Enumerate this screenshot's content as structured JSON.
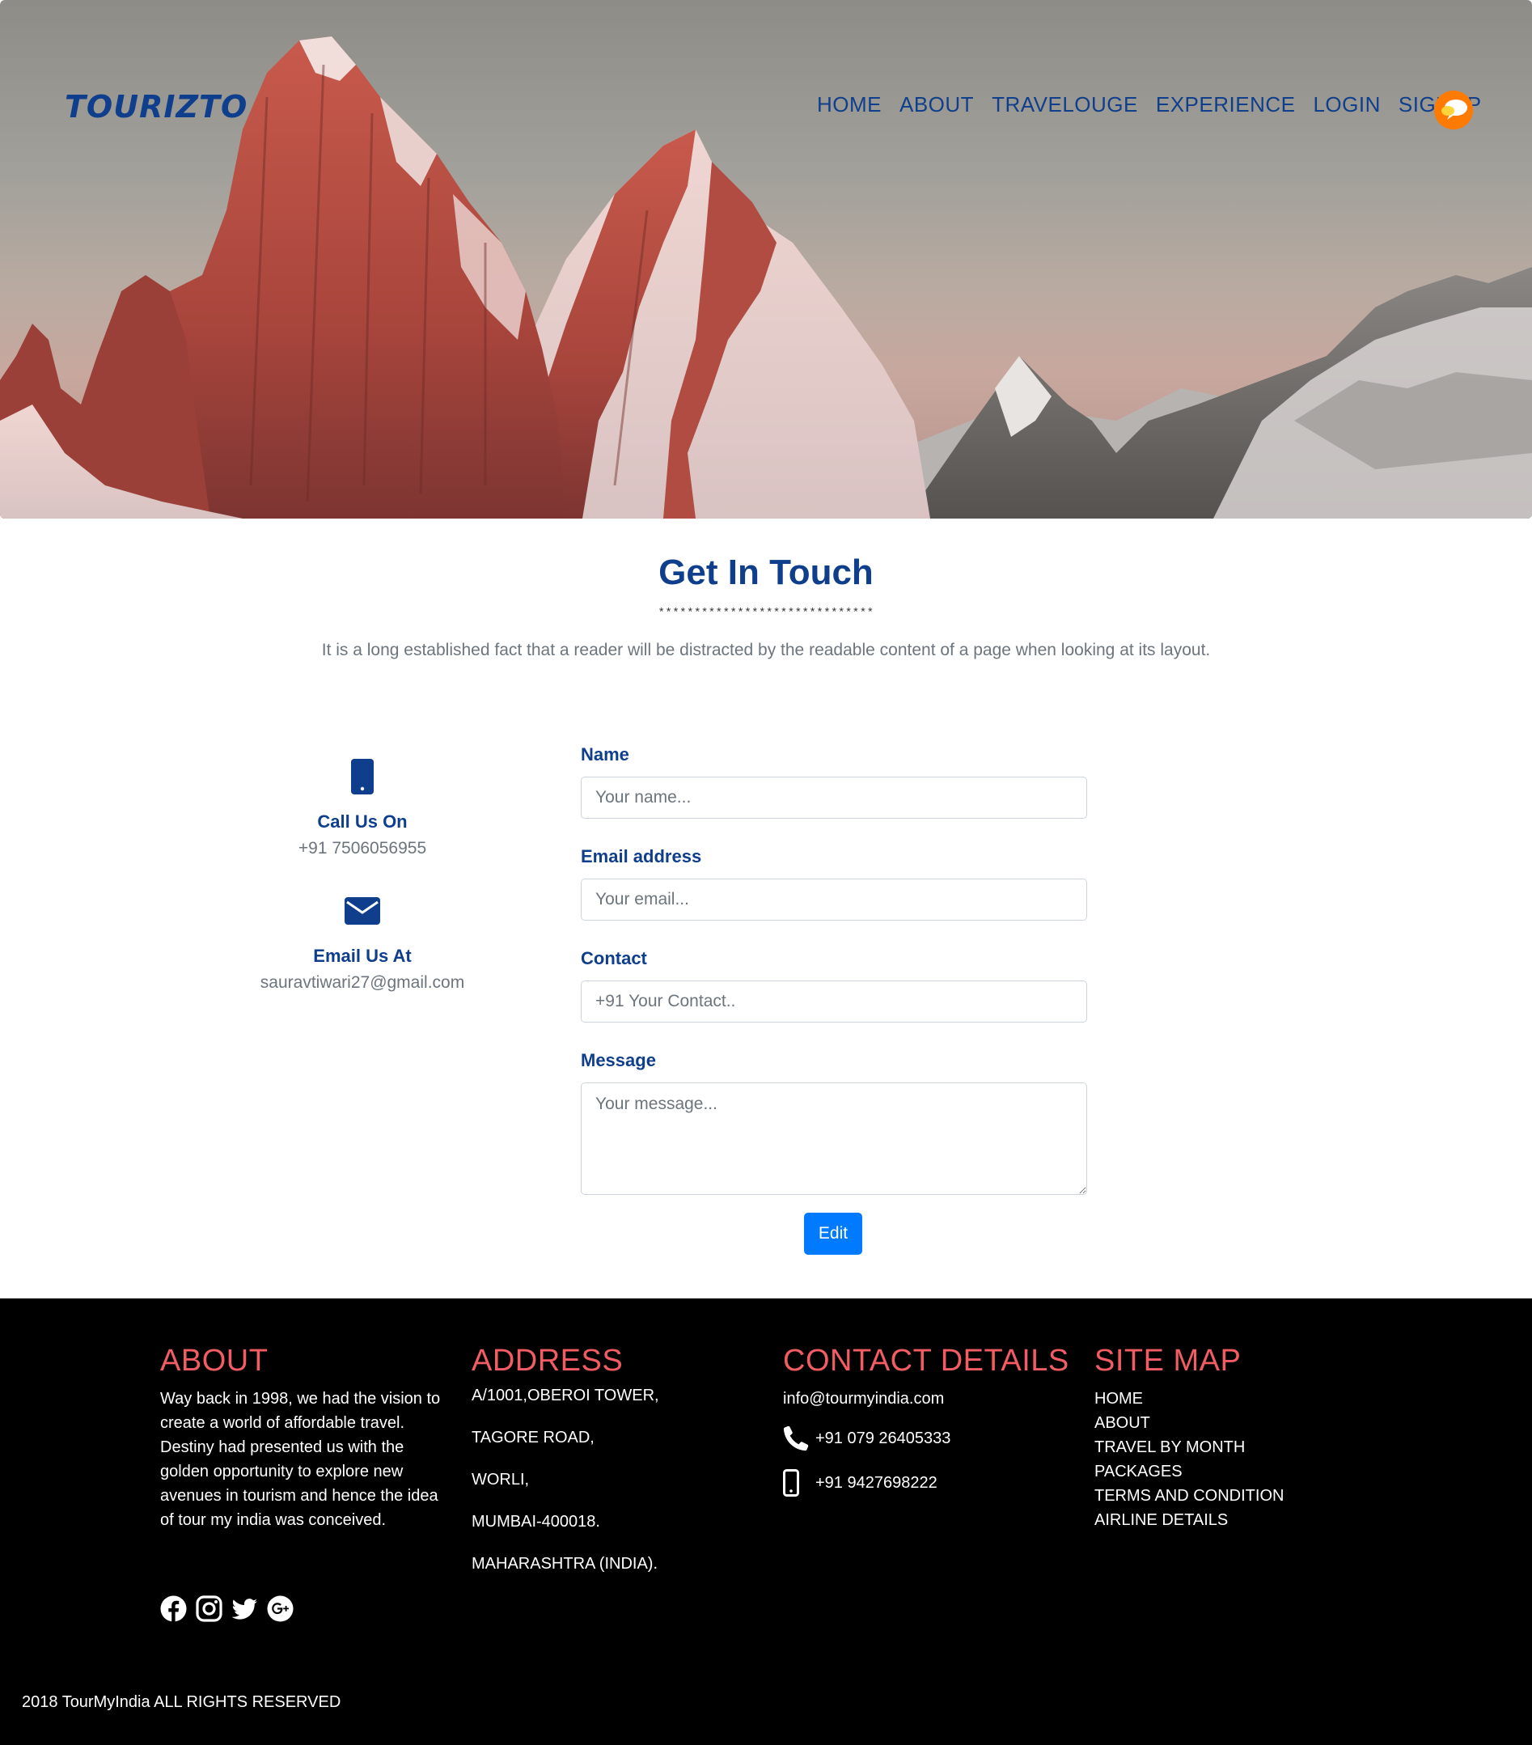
{
  "brand": {
    "logo": "TOURIZTO"
  },
  "nav": {
    "items": [
      "HOME",
      "ABOUT",
      "TRAVELOUGE",
      "EXPERIENCE",
      "LOGIN",
      "SIGNUP"
    ],
    "avatar_icon": "chat-bubble-avatar-icon"
  },
  "contact": {
    "title_light": "Get In",
    "title_bold": "Touch",
    "divider": "******************************",
    "lead": "It is a long established fact that a reader will be distracted by the readable content of a page when looking at its layout.",
    "call": {
      "icon": "mobile-phone-icon",
      "title": "Call Us On",
      "value": "+91 7506056955"
    },
    "email": {
      "icon": "envelope-icon",
      "title": "Email Us At",
      "value": "sauravtiwari27@gmail.com"
    }
  },
  "form": {
    "name": {
      "label": "Name",
      "placeholder": "Your name..."
    },
    "email": {
      "label": "Email address",
      "placeholder": "Your email..."
    },
    "contact": {
      "label": "Contact",
      "placeholder": "+91 Your Contact.."
    },
    "message": {
      "label": "Message",
      "placeholder": "Your message..."
    },
    "submit_label": "Edit"
  },
  "footer": {
    "about": {
      "heading": "ABOUT",
      "text": "Way back in 1998, we had the vision to create a world of affordable travel. Destiny had presented us with the golden opportunity to explore new avenues in tourism and hence the idea of tour my india was conceived."
    },
    "address": {
      "heading": "ADDRESS",
      "lines": [
        "A/1001,OBEROI TOWER,",
        "TAGORE ROAD,",
        "WORLI,",
        "MUMBAI-400018.",
        "MAHARASHTRA (INDIA)."
      ]
    },
    "contact_details": {
      "heading": "CONTACT DETAILS",
      "email": "info@tourmyindia.com",
      "phone": "+91 079 26405333",
      "mobile": "+91 9427698222"
    },
    "sitemap": {
      "heading": "SITE MAP",
      "links": [
        "HOME",
        "ABOUT",
        "TRAVEL BY MONTH",
        "PACKAGES",
        "TERMS AND CONDITION",
        "AIRLINE DETAILS"
      ]
    },
    "socials": [
      "facebook-icon",
      "instagram-icon",
      "twitter-icon",
      "google-plus-icon"
    ],
    "copyright": "2018 TourMyIndia ALL RIGHTS RESERVED"
  },
  "colors": {
    "primary_navy": "#0f3f8c",
    "button_blue": "#007bff",
    "footer_heading": "#f25c63",
    "footer_bg": "#000000",
    "muted_text": "#6c757d"
  }
}
